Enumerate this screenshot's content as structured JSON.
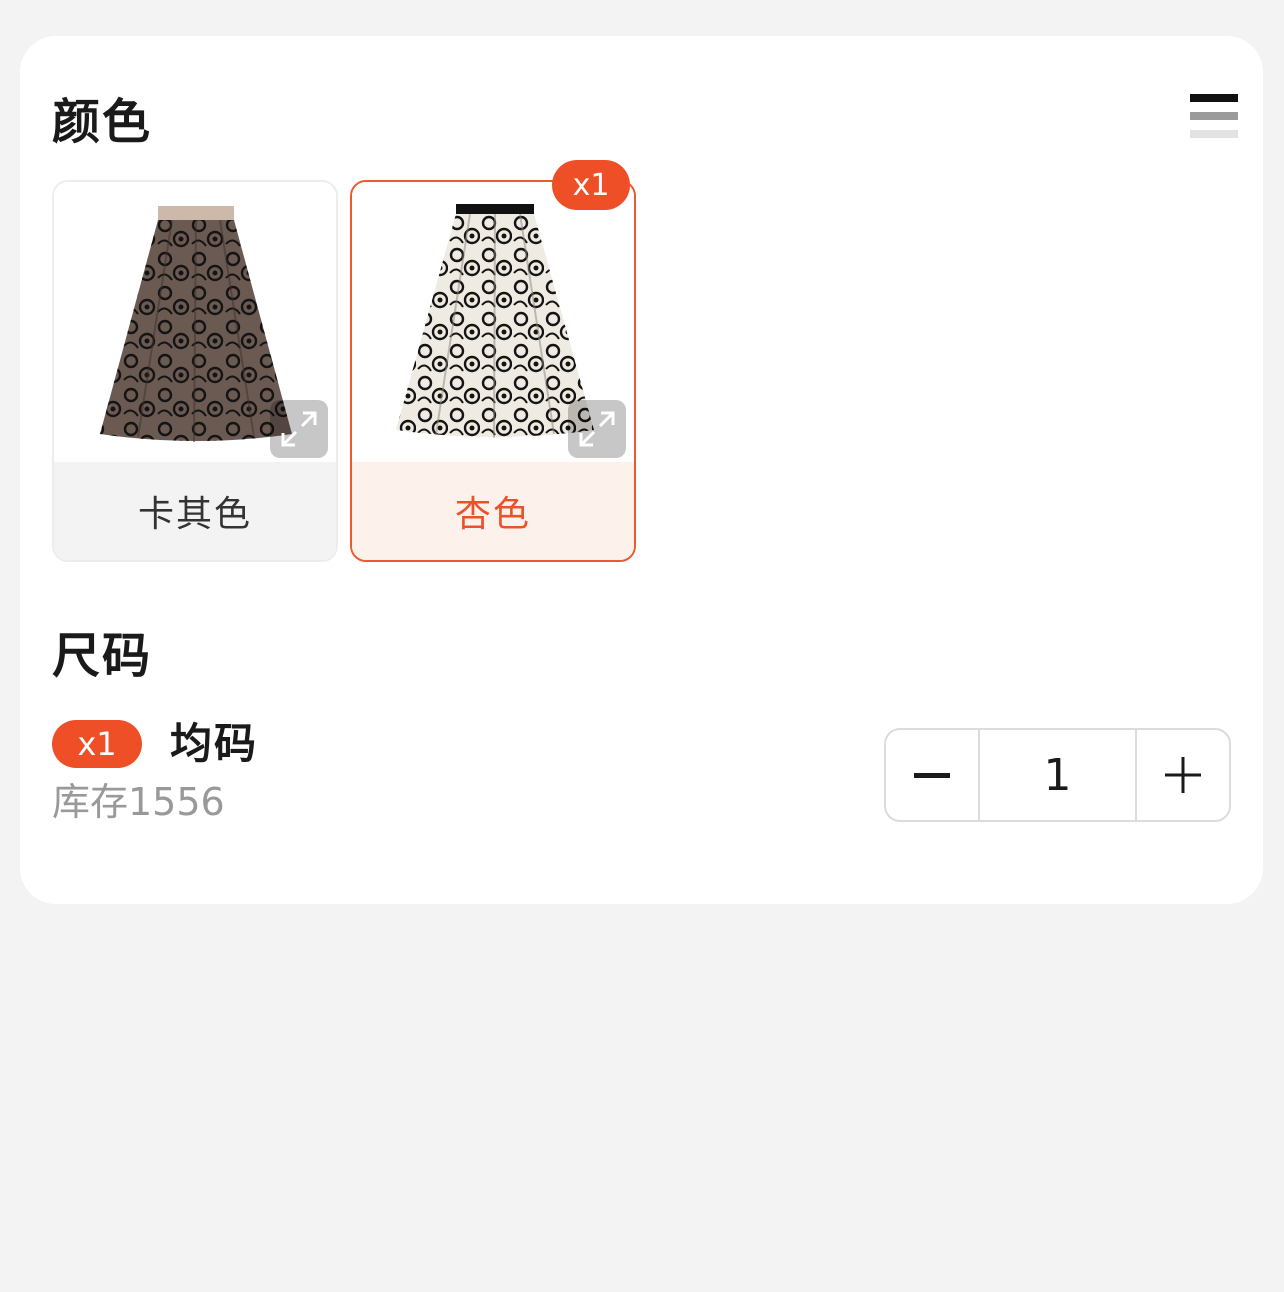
{
  "color_section": {
    "title": "颜色",
    "options": [
      {
        "label": "卡其色",
        "selected": false
      },
      {
        "label": "杏色",
        "selected": true,
        "badge": "x1"
      }
    ]
  },
  "size_section": {
    "title": "尺码",
    "item": {
      "badge": "x1",
      "name": "均码",
      "stock": "库存1556"
    },
    "quantity": "1"
  },
  "colors": {
    "accent": "#ee4f27",
    "selected_border": "#ee5a2f",
    "selected_bg": "#fdf1ec"
  },
  "icons": {
    "view_toggle": "list-view-icon",
    "expand": "expand-icon",
    "minus": "minus-icon",
    "plus": "plus-icon"
  }
}
